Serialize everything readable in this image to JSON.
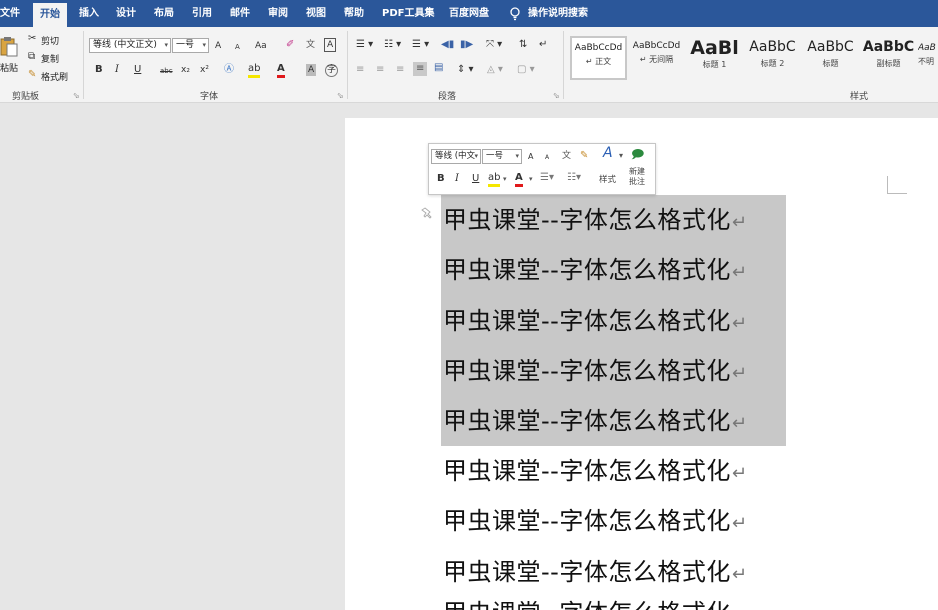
{
  "tabs": [
    {
      "label": "文件",
      "active": false
    },
    {
      "label": "开始",
      "active": true
    },
    {
      "label": "插入",
      "active": false
    },
    {
      "label": "设计",
      "active": false
    },
    {
      "label": "布局",
      "active": false
    },
    {
      "label": "引用",
      "active": false
    },
    {
      "label": "邮件",
      "active": false
    },
    {
      "label": "审阅",
      "active": false
    },
    {
      "label": "视图",
      "active": false
    },
    {
      "label": "帮助",
      "active": false
    },
    {
      "label": "PDF工具集",
      "active": false
    },
    {
      "label": "百度网盘",
      "active": false
    }
  ],
  "tell_me": {
    "label": "操作说明搜索",
    "icon": "lightbulb-icon"
  },
  "colors": {
    "title_bar": "#2b579a",
    "ribbon": "#f3f3f3",
    "canvas": "#e6e6e6",
    "page": "#ffffff",
    "selection": "#c8c8c8"
  },
  "clipboard": {
    "paste_label": "粘贴",
    "cut_label": "剪切",
    "copy_label": "复制",
    "format_painter_label": "格式刷",
    "group_label": "剪贴板"
  },
  "font_group": {
    "font_name": "等线 (中文正文)",
    "font_size": "一号",
    "group_label": "字体",
    "buttons": {
      "grow": "A",
      "shrink": "A",
      "case": "Aa",
      "bold": "B",
      "italic": "I",
      "underline": "U",
      "strike": "abc",
      "subscript": "x₂",
      "superscript": "x²",
      "font_color": "A",
      "char_shading": "A",
      "enclose": "字"
    }
  },
  "paragraph_group": {
    "group_label": "段落"
  },
  "styles_group": {
    "group_label": "样式",
    "items": [
      {
        "sample": "AaBbCcDd",
        "name": "↵ 正文"
      },
      {
        "sample": "AaBbCcDd",
        "name": "↵ 无间隔"
      },
      {
        "sample": "AaBl",
        "name": "标题 1"
      },
      {
        "sample": "AaBbC",
        "name": "标题 2"
      },
      {
        "sample": "AaBbC",
        "name": "标题"
      },
      {
        "sample": "AaBbC",
        "name": "副标题"
      },
      {
        "sample": "AaB",
        "name": "不明"
      }
    ]
  },
  "mini_toolbar": {
    "font_name": "等线 (中文",
    "font_size": "一号",
    "styles_label": "样式",
    "new_comment_label": "新建批注",
    "bold": "B",
    "italic": "I",
    "underline": "U",
    "font_color": "A"
  },
  "document": {
    "lines": [
      "甲虫课堂--字体怎么格式化",
      "甲虫课堂--字体怎么格式化",
      "甲虫课堂--字体怎么格式化",
      "甲虫课堂--字体怎么格式化",
      "甲虫课堂--字体怎么格式化",
      "甲虫课堂--字体怎么格式化",
      "甲虫课堂--字体怎么格式化",
      "甲虫课堂--字体怎么格式化",
      "甲虫课堂--字体怎么格式化"
    ],
    "paragraph_mark": "↵",
    "selected_line_count": 5
  }
}
